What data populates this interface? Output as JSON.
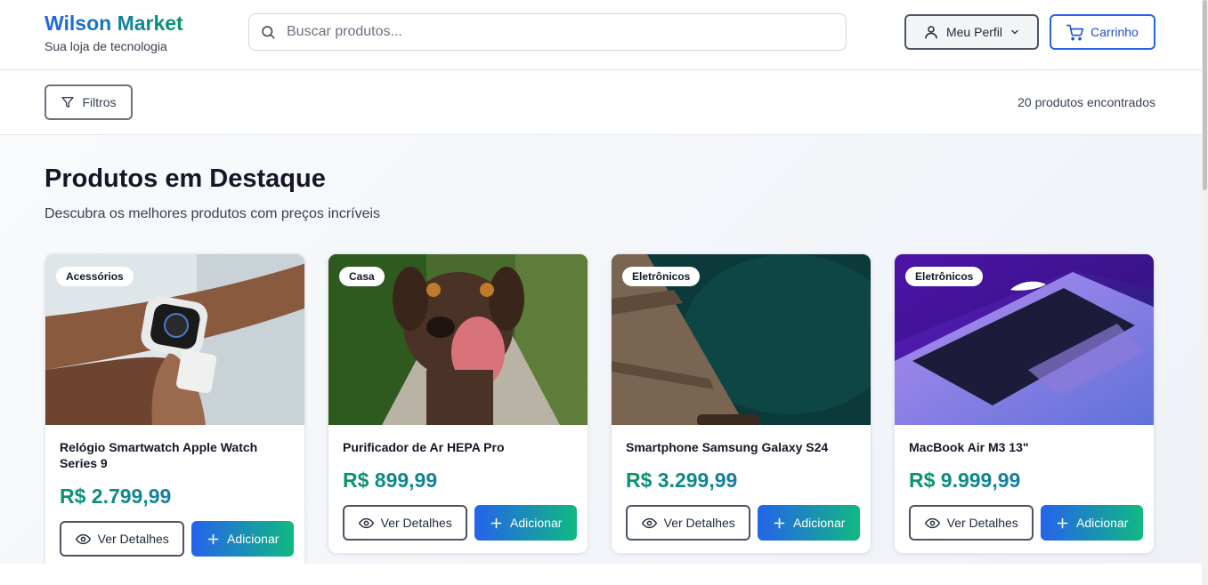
{
  "header": {
    "brand_name": "Wilson Market",
    "brand_tagline": "Sua loja de tecnologia",
    "search_placeholder": "Buscar produtos...",
    "search_icon": "search-icon",
    "profile_label": "Meu Perfil",
    "profile_icon": "user-icon",
    "cart_label": "Carrinho",
    "cart_icon": "cart-icon"
  },
  "filters": {
    "button_label": "Filtros",
    "button_icon": "filter-icon",
    "results_count": "20 produtos encontrados"
  },
  "hero": {
    "title": "Produtos em Destaque",
    "subtitle": "Descubra os melhores produtos com preços incríveis"
  },
  "products": [
    {
      "category": "Acessórios",
      "name": "Relógio Smartwatch Apple Watch Series 9",
      "price": "R$ 2.799,99",
      "details_label": "Ver Detalhes",
      "add_label": "Adicionar"
    },
    {
      "category": "Casa",
      "name": "Purificador de Ar HEPA Pro",
      "price": "R$ 899,99",
      "details_label": "Ver Detalhes",
      "add_label": "Adicionar"
    },
    {
      "category": "Eletrônicos",
      "name": "Smartphone Samsung Galaxy S24",
      "price": "R$ 3.299,99",
      "details_label": "Ver Detalhes",
      "add_label": "Adicionar"
    },
    {
      "category": "Eletrônicos",
      "name": "MacBook Air M3 13\"",
      "price": "R$ 9.999,99",
      "details_label": "Ver Detalhes",
      "add_label": "Adicionar"
    }
  ],
  "colors": {
    "brand_blue": "#2563eb",
    "brand_green": "#059669",
    "add_gradient_end": "#10b981"
  }
}
